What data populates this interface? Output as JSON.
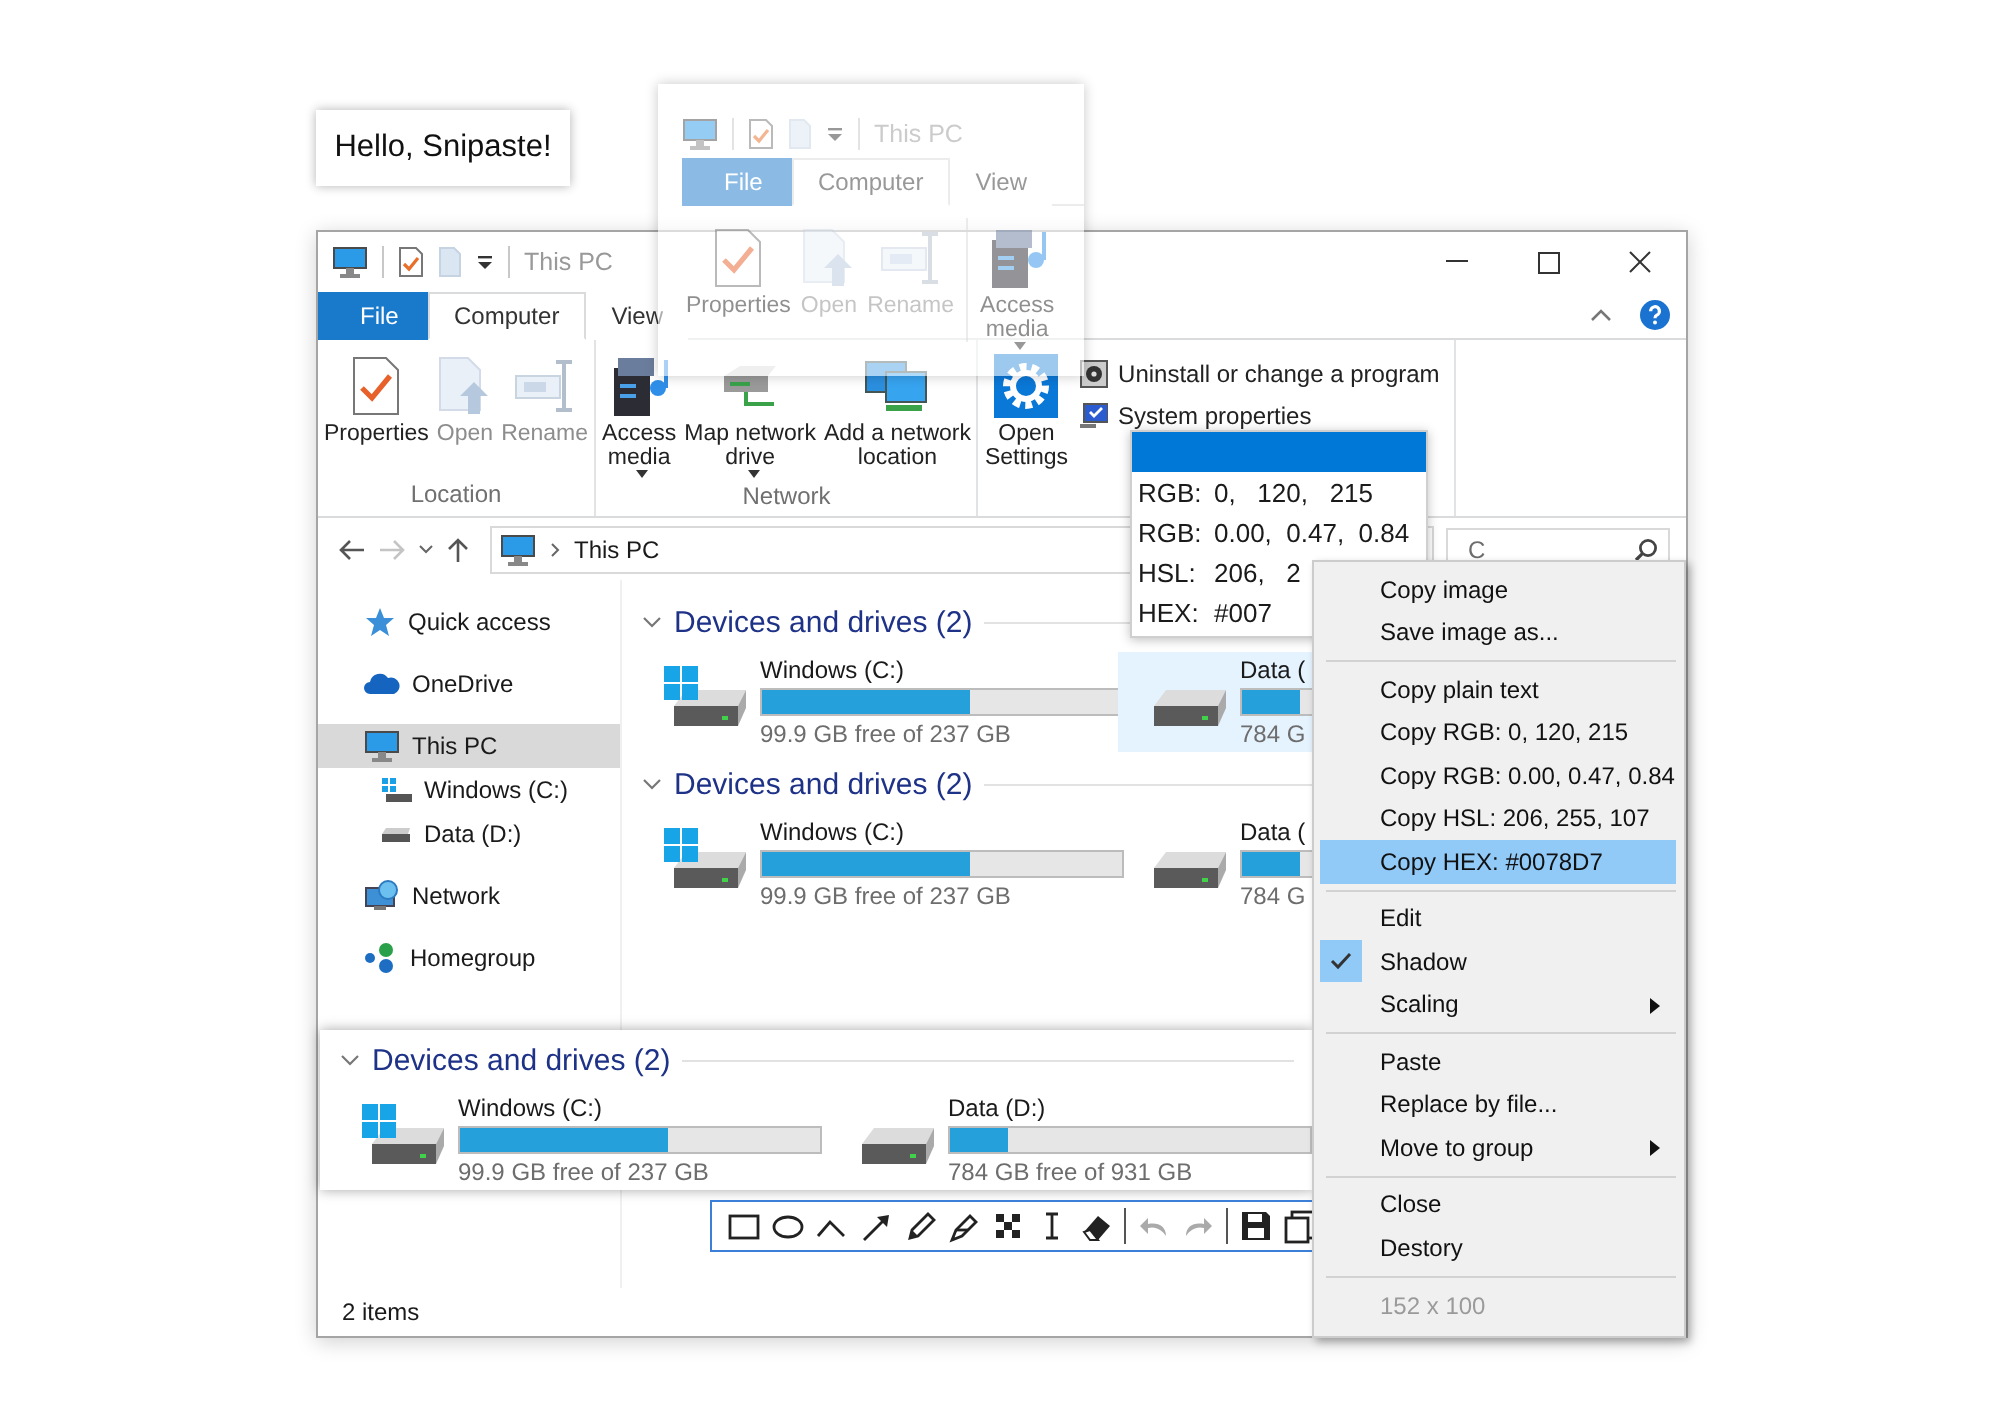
{
  "note": {
    "text": "Hello, Snipaste!"
  },
  "explorer": {
    "title": "This PC",
    "tabs": [
      {
        "label": "File",
        "kind": "file",
        "selected": false
      },
      {
        "label": "Computer",
        "kind": "tab",
        "selected": true
      },
      {
        "label": "View",
        "kind": "tab",
        "selected": false
      }
    ],
    "ribbon": {
      "groups": [
        {
          "label": "Location",
          "buttons": [
            {
              "label": "Properties",
              "kind": "properties",
              "disabled": false,
              "dropdown": false
            },
            {
              "label": "Open",
              "kind": "open",
              "disabled": true,
              "dropdown": false
            },
            {
              "label": "Rename",
              "kind": "rename",
              "disabled": true,
              "dropdown": false
            }
          ]
        },
        {
          "label": "Network",
          "buttons": [
            {
              "label": "Access\nmedia",
              "kind": "media",
              "disabled": false,
              "dropdown": true
            },
            {
              "label": "Map network\ndrive",
              "kind": "mapdrive",
              "disabled": false,
              "dropdown": true
            },
            {
              "label": "Add a network\nlocation",
              "kind": "addnet",
              "disabled": false,
              "dropdown": false
            }
          ]
        },
        {
          "buttons": [
            {
              "label": "Open\nSettings",
              "kind": "settings",
              "disabled": false,
              "dropdown": false
            }
          ],
          "links": [
            {
              "label": "Uninstall or change a program",
              "kind": "uninstall"
            },
            {
              "label": "System properties",
              "kind": "sysprops"
            }
          ]
        }
      ]
    },
    "address": "This PC",
    "search_placeholder": "C",
    "sidebar": {
      "items": [
        {
          "label": "Quick access",
          "kind": "quick",
          "selected": false
        },
        {
          "label": "OneDrive",
          "kind": "cloud",
          "selected": false
        },
        {
          "label": "This PC",
          "kind": "pc",
          "selected": true,
          "children": [
            {
              "label": "Windows (C:)",
              "kind": "system",
              "selected": false
            },
            {
              "label": "Data (D:)",
              "kind": "data",
              "selected": false
            }
          ]
        },
        {
          "label": "Network",
          "kind": "network",
          "selected": false
        },
        {
          "label": "Homegroup",
          "kind": "homegroup",
          "selected": false
        }
      ]
    },
    "groups": [
      {
        "title": "Devices and drives (2)",
        "expanded": true,
        "drives": [
          {
            "name": "Windows (C:)",
            "kind": "system",
            "level": 0.58,
            "free": "99.9 GB free of 237 GB",
            "selected": false
          },
          {
            "name": "Data (",
            "kind": "data",
            "level": 0.16,
            "free": "784 G",
            "selected": true
          }
        ]
      },
      {
        "title": "Devices and drives (2)",
        "expanded": true,
        "drives": [
          {
            "name": "Windows (C:)",
            "kind": "system",
            "level": 0.58,
            "free": "99.9 GB free of 237 GB",
            "selected": false
          },
          {
            "name": "Data (",
            "kind": "data",
            "level": 0.16,
            "free": "784 G",
            "selected": false
          }
        ]
      }
    ],
    "status_bar": {
      "text": "2 items"
    }
  },
  "snip": {
    "title": "This PC",
    "tabs": [
      {
        "label": "File",
        "kind": "file",
        "selected": false
      },
      {
        "label": "Computer",
        "kind": "tab",
        "selected": true
      },
      {
        "label": "View",
        "kind": "tab",
        "selected": false
      }
    ],
    "buttons": [
      {
        "label": "Properties",
        "kind": "properties",
        "disabled": false,
        "dropdown": false
      },
      {
        "label": "Open",
        "kind": "open",
        "disabled": true,
        "dropdown": false
      },
      {
        "label": "Rename",
        "kind": "rename",
        "disabled": true,
        "dropdown": false
      },
      {
        "label": "Access\nmedia",
        "kind": "media",
        "disabled": false,
        "dropdown": true
      }
    ]
  },
  "color_popup": {
    "color": "#0078d7",
    "rows": [
      {
        "label": "RGB:",
        "value": "0,   120,   215"
      },
      {
        "label": "RGB:",
        "value": "0.00,  0.47,  0.84"
      },
      {
        "label": "HSL:",
        "value": "206,   2"
      },
      {
        "label": "HEX:",
        "value": "#007"
      }
    ]
  },
  "pasted_strip": {
    "title": "Devices and drives (2)",
    "expanded": true,
    "drives": [
      {
        "name": "Windows (C:)",
        "kind": "system",
        "level": 0.58,
        "free": "99.9 GB free of 237 GB",
        "selected": false
      },
      {
        "name": "Data (D:)",
        "kind": "data",
        "level": 0.16,
        "free": "784 GB free of 931 GB",
        "selected": false
      }
    ]
  },
  "context_menu": {
    "sections": [
      [
        {
          "label": "Copy image",
          "kind": "item",
          "checked": false,
          "selected": false
        },
        {
          "label": "Save image as...",
          "kind": "item",
          "checked": false,
          "selected": false
        }
      ],
      [
        {
          "label": "Copy plain text",
          "kind": "item",
          "checked": false,
          "selected": false
        },
        {
          "label": "Copy RGB: 0, 120, 215",
          "kind": "item",
          "checked": false,
          "selected": false
        },
        {
          "label": "Copy RGB: 0.00, 0.47, 0.84",
          "kind": "item",
          "checked": false,
          "selected": false
        },
        {
          "label": "Copy HSL: 206, 255, 107",
          "kind": "item",
          "checked": false,
          "selected": false
        },
        {
          "label": "Copy HEX: #0078D7",
          "kind": "item",
          "checked": false,
          "selected": true
        }
      ],
      [
        {
          "label": "Edit",
          "kind": "item",
          "checked": false,
          "selected": false
        },
        {
          "label": "Shadow",
          "kind": "item",
          "checked": true,
          "selected": false
        },
        {
          "label": "Scaling",
          "kind": "submenu",
          "checked": false,
          "selected": false
        }
      ],
      [
        {
          "label": "Paste",
          "kind": "item",
          "checked": false,
          "selected": false
        },
        {
          "label": "Replace by file...",
          "kind": "item",
          "checked": false,
          "selected": false
        },
        {
          "label": "Move to group",
          "kind": "submenu",
          "checked": false,
          "selected": false
        }
      ],
      [
        {
          "label": "Close",
          "kind": "item",
          "checked": false,
          "selected": false
        },
        {
          "label": "Destory",
          "kind": "item",
          "checked": false,
          "selected": false
        }
      ]
    ],
    "size": "152 x 100"
  }
}
